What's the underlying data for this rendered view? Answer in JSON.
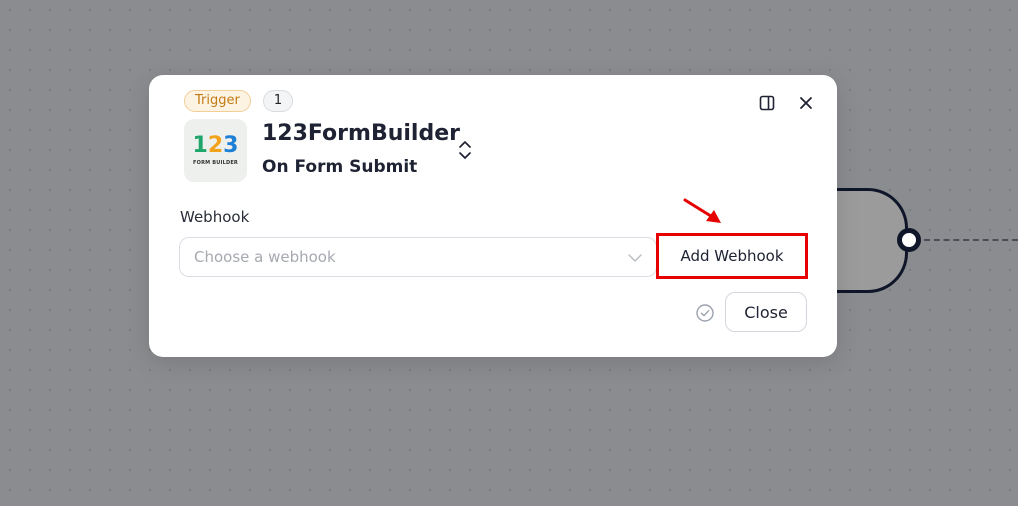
{
  "modal": {
    "badge_trigger": "Trigger",
    "badge_count": "1",
    "app_name": "123FormBuilder",
    "app_event": "On Form Submit",
    "logo": {
      "digits": [
        "1",
        "2",
        "3"
      ],
      "caption": "FORM BUILDER"
    },
    "webhook_field": {
      "label": "Webhook",
      "placeholder": "Choose a webhook"
    },
    "add_webhook_label": "Add Webhook",
    "close_label": "Close",
    "icons": {
      "sidebar": "sidebar-panel-icon",
      "close": "close-icon",
      "swap": "chevron-up-down-icon",
      "dropdown": "chevron-down-icon",
      "status": "check-circle-icon"
    }
  },
  "colors": {
    "highlight": "#e60000",
    "trigger_badge_text": "#c27a12",
    "trigger_badge_bg": "#fdf3e3"
  }
}
